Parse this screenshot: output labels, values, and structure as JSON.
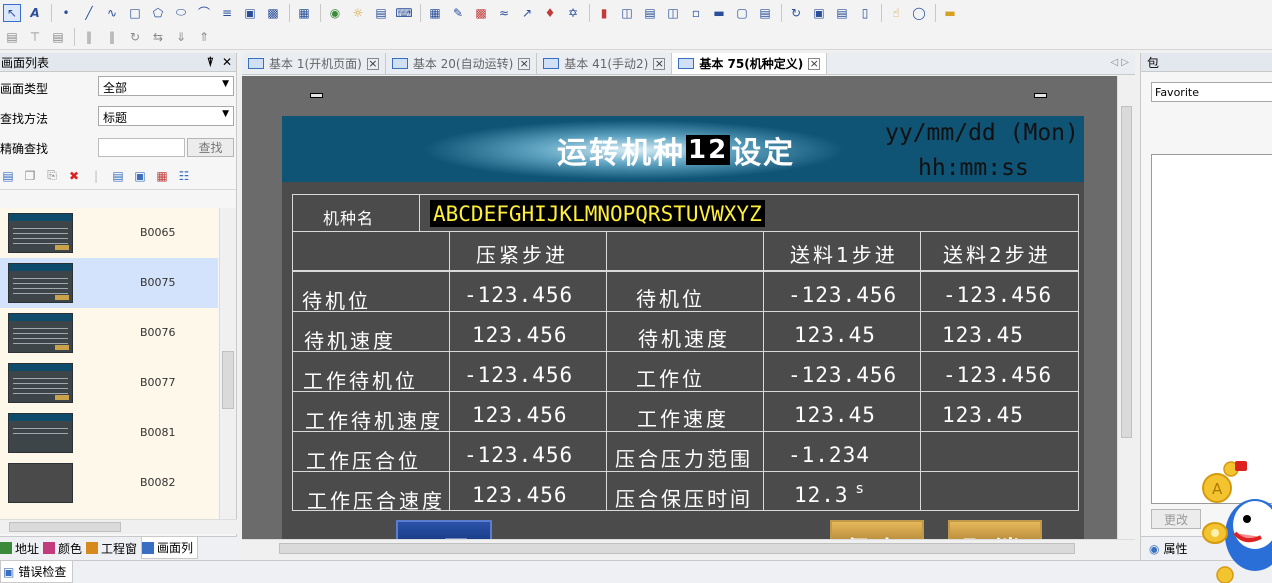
{
  "left_panel": {
    "title": "画面列表",
    "pin_icon": "pin-icon",
    "close_icon": "close-icon",
    "screen_type_label": "画面类型",
    "screen_type_value": "全部",
    "search_method_label": "查找方法",
    "search_method_value": "标题",
    "exact_search_label": "精确查找",
    "search_button": "查找",
    "thumbnails": [
      {
        "id": "B0065"
      },
      {
        "id": "B0075"
      },
      {
        "id": "B0076"
      },
      {
        "id": "B0077"
      },
      {
        "id": "B0081"
      },
      {
        "id": "B0082"
      }
    ],
    "bottom_tabs": [
      {
        "label": "地址",
        "color": "#3a8a3a"
      },
      {
        "label": "颜色",
        "color": "#c23b7a"
      },
      {
        "label": "工程窗",
        "color": "#d68a1c"
      },
      {
        "label": "画面列",
        "color": "#3a6ec0"
      }
    ]
  },
  "doc_tabs": [
    {
      "label": "基本 1(开机页面)"
    },
    {
      "label": "基本 20(自动运转)"
    },
    {
      "label": "基本 41(手动2)"
    },
    {
      "label": "基本 75(机种定义)"
    }
  ],
  "screen": {
    "title_prefix": "运转机种",
    "title_num": "12",
    "title_suffix": "设定",
    "date_format": "yy/mm/dd (Mon)",
    "time_format": "hh:mm:ss",
    "model_label": "机种名",
    "model_value": "ABCDEFGHIJKLMNOPQRSTUVWXYZ",
    "headers": {
      "press_step": "压紧步进",
      "feed1_step": "送料1步进",
      "feed2_step": "送料2步进"
    },
    "rows": [
      {
        "label_left": "待机位",
        "press": "-123.456",
        "label_right": "待机位",
        "feed1": "-123.456",
        "feed2": "-123.456"
      },
      {
        "label_left": "待机速度",
        "press": "123.456",
        "label_right": "待机速度",
        "feed1": "123.45",
        "feed2": "123.45"
      },
      {
        "label_left": "工作待机位",
        "press": "-123.456",
        "label_right": "工作位",
        "feed1": "-123.456",
        "feed2": "-123.456"
      },
      {
        "label_left": "工作待机速度",
        "press": "123.456",
        "label_right": "工作速度",
        "feed1": "123.45",
        "feed2": "123.45"
      },
      {
        "label_left": "工作压合位",
        "press": "-123.456",
        "label_right": "压合压力范围",
        "feed1": "-1.234",
        "feed2": ""
      },
      {
        "label_left": "工作压合速度",
        "press": "123.456",
        "label_right": "压合保压时间",
        "feed1": "12.3",
        "feed1_unit": "s",
        "feed2": ""
      }
    ],
    "btn_home": "下页",
    "btn_save": "保存",
    "btn_cancel": "取消"
  },
  "right_panel": {
    "title": "包",
    "select_value": "Favorite",
    "button": "更改",
    "tab_label": "属性"
  },
  "status_bar": {
    "tab_label": "错误检查"
  },
  "colors": {
    "canvas_bg": "#6b6b6b",
    "screen_bg": "#4b4b4b",
    "title_bar": "#0f5375",
    "model_text": "#ffef3a",
    "button_gold": "#c09a4a"
  }
}
